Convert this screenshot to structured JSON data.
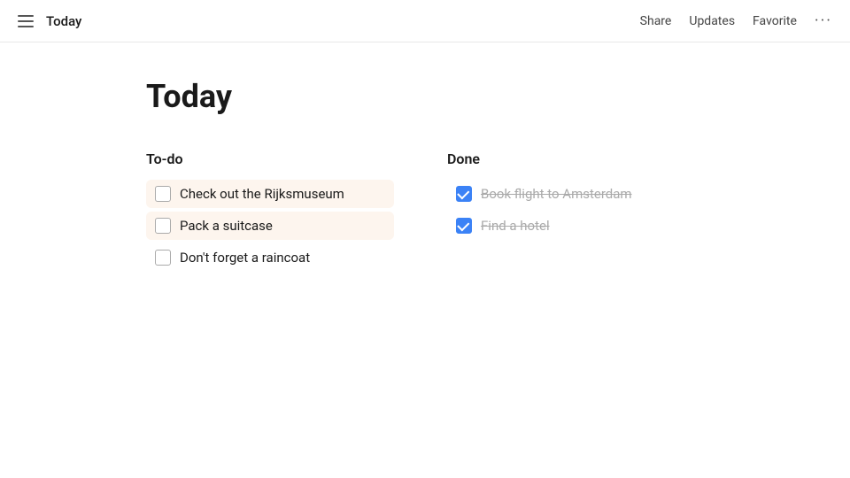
{
  "header": {
    "title": "Today",
    "actions": {
      "share": "Share",
      "updates": "Updates",
      "favorite": "Favorite",
      "more": "···"
    }
  },
  "page": {
    "title": "Today"
  },
  "todo_section": {
    "title": "To-do",
    "items": [
      {
        "id": 1,
        "label": "Check out the Rijksmuseum",
        "checked": false,
        "highlighted": true
      },
      {
        "id": 2,
        "label": "Pack a suitcase",
        "checked": false,
        "highlighted": true
      },
      {
        "id": 3,
        "label": "Don't forget a raincoat",
        "checked": false,
        "highlighted": false
      }
    ]
  },
  "done_section": {
    "title": "Done",
    "items": [
      {
        "id": 1,
        "label": "Book flight to Amsterdam",
        "checked": true
      },
      {
        "id": 2,
        "label": "Find a hotel",
        "checked": true
      }
    ]
  }
}
